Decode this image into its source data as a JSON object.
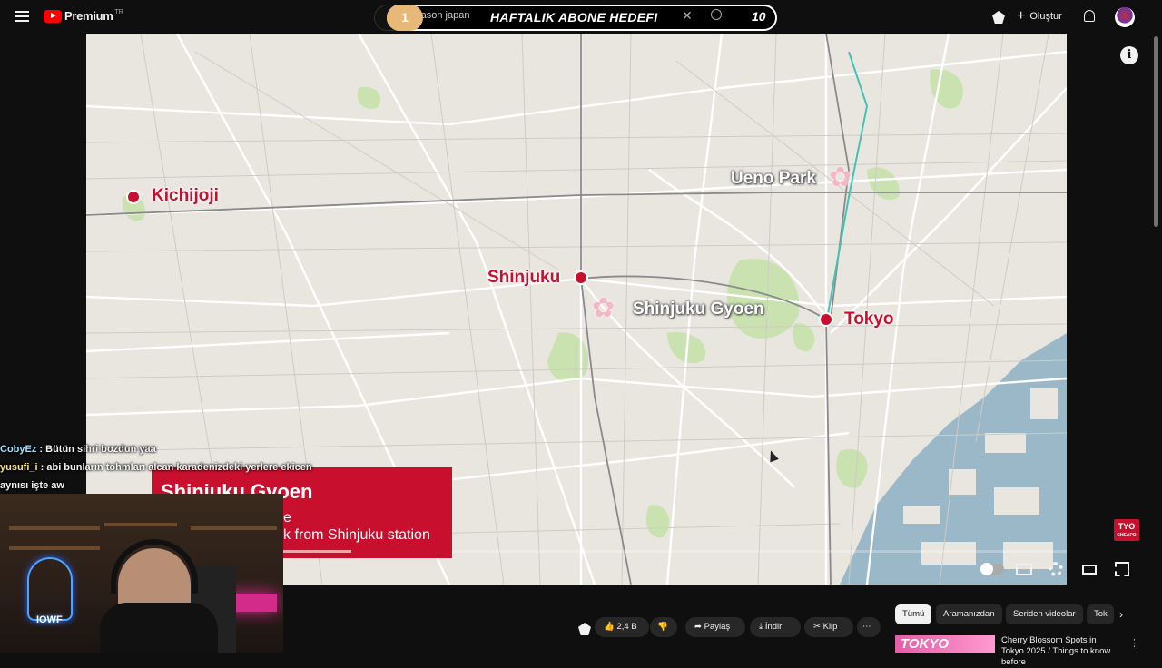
{
  "topbar": {
    "logo_text": "Premium",
    "logo_region": "TR",
    "search_query": "season japan",
    "create_label": "Oluştur"
  },
  "overlay": {
    "left_number": "1",
    "title": "HAFTALIK ABONE HEDEFI",
    "right_number": "10"
  },
  "map": {
    "labels": {
      "kichijoji": "Kichijoji",
      "shinjuku": "Shinjuku",
      "shinjuku_gyoen": "Shinjuku Gyoen",
      "ueno_park": "Ueno Park",
      "tokyo": "Tokyo"
    }
  },
  "player": {
    "progress_fraction": 0.0,
    "channel_badge": "TYO",
    "channel_badge_sub": "CHEAPO"
  },
  "caption": {
    "title": "Shinjuku Gyoen",
    "line1": "e",
    "line2": "k from Shinjuku station"
  },
  "chat": [
    {
      "user": "CobyEz",
      "message": "Bütün sihri bozdun yaa"
    },
    {
      "user": "yusufi_i",
      "message": "abi bunların tohmları alcan karadenizdeki yerlere ekicen"
    },
    {
      "user": "",
      "message": "aynısı işte aw"
    }
  ],
  "webcam": {
    "neon_text": "IOWF"
  },
  "actions": {
    "likes": "2,4 B",
    "share": "Paylaş",
    "download": "İndir",
    "clip": "Klip",
    "more": "⋯"
  },
  "chips": [
    "Tümü",
    "Aramanızdan",
    "Seriden videolar",
    "Tok"
  ],
  "suggestion": {
    "thumb_text": "TOKYO",
    "title": "Cherry Blossom Spots in Tokyo 2025 / Things to know before"
  },
  "colors": {
    "accent_red": "#c8102e",
    "map_bg": "#e9e6e0",
    "park_green": "#c9e2b0",
    "water_blue": "#9bb8c8"
  }
}
